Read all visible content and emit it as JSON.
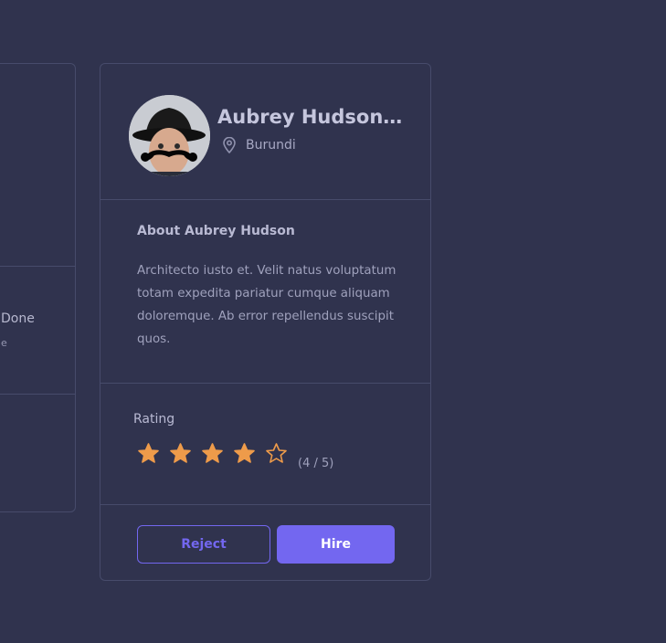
{
  "left_card": {
    "partial_text": "Done",
    "partial_sub": "e"
  },
  "profile": {
    "name": "Aubrey Hudson S…",
    "location": "Burundi"
  },
  "about": {
    "title": "About Aubrey Hudson",
    "text": "Architecto iusto et. Velit natus voluptatum totam expedita pariatur cumque aliquam doloremque. Ab error repellendus suscipit quos."
  },
  "rating": {
    "label": "Rating",
    "value": 4,
    "max": 5,
    "count_text": "(4 / 5)"
  },
  "actions": {
    "reject_label": "Reject",
    "hire_label": "Hire"
  },
  "colors": {
    "accent": "#7367f0",
    "star": "#ee9b4a",
    "border": "#474b6b",
    "background": "#30334e"
  },
  "icons": {
    "location": "map-pin-icon",
    "star_filled": "star-filled-icon",
    "star_empty": "star-outline-icon"
  }
}
